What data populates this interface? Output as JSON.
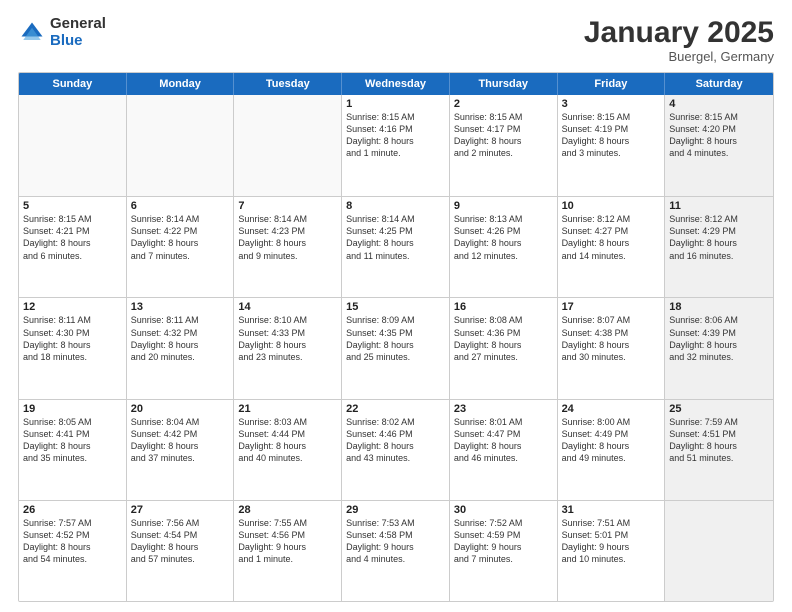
{
  "header": {
    "logo_general": "General",
    "logo_blue": "Blue",
    "month_title": "January 2025",
    "location": "Buergel, Germany"
  },
  "days_of_week": [
    "Sunday",
    "Monday",
    "Tuesday",
    "Wednesday",
    "Thursday",
    "Friday",
    "Saturday"
  ],
  "weeks": [
    [
      {
        "day": "",
        "info": "",
        "empty": true
      },
      {
        "day": "",
        "info": "",
        "empty": true
      },
      {
        "day": "",
        "info": "",
        "empty": true
      },
      {
        "day": "1",
        "info": "Sunrise: 8:15 AM\nSunset: 4:16 PM\nDaylight: 8 hours\nand 1 minute."
      },
      {
        "day": "2",
        "info": "Sunrise: 8:15 AM\nSunset: 4:17 PM\nDaylight: 8 hours\nand 2 minutes."
      },
      {
        "day": "3",
        "info": "Sunrise: 8:15 AM\nSunset: 4:19 PM\nDaylight: 8 hours\nand 3 minutes."
      },
      {
        "day": "4",
        "info": "Sunrise: 8:15 AM\nSunset: 4:20 PM\nDaylight: 8 hours\nand 4 minutes.",
        "shaded": true
      }
    ],
    [
      {
        "day": "5",
        "info": "Sunrise: 8:15 AM\nSunset: 4:21 PM\nDaylight: 8 hours\nand 6 minutes."
      },
      {
        "day": "6",
        "info": "Sunrise: 8:14 AM\nSunset: 4:22 PM\nDaylight: 8 hours\nand 7 minutes."
      },
      {
        "day": "7",
        "info": "Sunrise: 8:14 AM\nSunset: 4:23 PM\nDaylight: 8 hours\nand 9 minutes."
      },
      {
        "day": "8",
        "info": "Sunrise: 8:14 AM\nSunset: 4:25 PM\nDaylight: 8 hours\nand 11 minutes."
      },
      {
        "day": "9",
        "info": "Sunrise: 8:13 AM\nSunset: 4:26 PM\nDaylight: 8 hours\nand 12 minutes."
      },
      {
        "day": "10",
        "info": "Sunrise: 8:12 AM\nSunset: 4:27 PM\nDaylight: 8 hours\nand 14 minutes."
      },
      {
        "day": "11",
        "info": "Sunrise: 8:12 AM\nSunset: 4:29 PM\nDaylight: 8 hours\nand 16 minutes.",
        "shaded": true
      }
    ],
    [
      {
        "day": "12",
        "info": "Sunrise: 8:11 AM\nSunset: 4:30 PM\nDaylight: 8 hours\nand 18 minutes."
      },
      {
        "day": "13",
        "info": "Sunrise: 8:11 AM\nSunset: 4:32 PM\nDaylight: 8 hours\nand 20 minutes."
      },
      {
        "day": "14",
        "info": "Sunrise: 8:10 AM\nSunset: 4:33 PM\nDaylight: 8 hours\nand 23 minutes."
      },
      {
        "day": "15",
        "info": "Sunrise: 8:09 AM\nSunset: 4:35 PM\nDaylight: 8 hours\nand 25 minutes."
      },
      {
        "day": "16",
        "info": "Sunrise: 8:08 AM\nSunset: 4:36 PM\nDaylight: 8 hours\nand 27 minutes."
      },
      {
        "day": "17",
        "info": "Sunrise: 8:07 AM\nSunset: 4:38 PM\nDaylight: 8 hours\nand 30 minutes."
      },
      {
        "day": "18",
        "info": "Sunrise: 8:06 AM\nSunset: 4:39 PM\nDaylight: 8 hours\nand 32 minutes.",
        "shaded": true
      }
    ],
    [
      {
        "day": "19",
        "info": "Sunrise: 8:05 AM\nSunset: 4:41 PM\nDaylight: 8 hours\nand 35 minutes."
      },
      {
        "day": "20",
        "info": "Sunrise: 8:04 AM\nSunset: 4:42 PM\nDaylight: 8 hours\nand 37 minutes."
      },
      {
        "day": "21",
        "info": "Sunrise: 8:03 AM\nSunset: 4:44 PM\nDaylight: 8 hours\nand 40 minutes."
      },
      {
        "day": "22",
        "info": "Sunrise: 8:02 AM\nSunset: 4:46 PM\nDaylight: 8 hours\nand 43 minutes."
      },
      {
        "day": "23",
        "info": "Sunrise: 8:01 AM\nSunset: 4:47 PM\nDaylight: 8 hours\nand 46 minutes."
      },
      {
        "day": "24",
        "info": "Sunrise: 8:00 AM\nSunset: 4:49 PM\nDaylight: 8 hours\nand 49 minutes."
      },
      {
        "day": "25",
        "info": "Sunrise: 7:59 AM\nSunset: 4:51 PM\nDaylight: 8 hours\nand 51 minutes.",
        "shaded": true
      }
    ],
    [
      {
        "day": "26",
        "info": "Sunrise: 7:57 AM\nSunset: 4:52 PM\nDaylight: 8 hours\nand 54 minutes."
      },
      {
        "day": "27",
        "info": "Sunrise: 7:56 AM\nSunset: 4:54 PM\nDaylight: 8 hours\nand 57 minutes."
      },
      {
        "day": "28",
        "info": "Sunrise: 7:55 AM\nSunset: 4:56 PM\nDaylight: 9 hours\nand 1 minute."
      },
      {
        "day": "29",
        "info": "Sunrise: 7:53 AM\nSunset: 4:58 PM\nDaylight: 9 hours\nand 4 minutes."
      },
      {
        "day": "30",
        "info": "Sunrise: 7:52 AM\nSunset: 4:59 PM\nDaylight: 9 hours\nand 7 minutes."
      },
      {
        "day": "31",
        "info": "Sunrise: 7:51 AM\nSunset: 5:01 PM\nDaylight: 9 hours\nand 10 minutes."
      },
      {
        "day": "",
        "info": "",
        "empty": true,
        "shaded": true
      }
    ]
  ]
}
